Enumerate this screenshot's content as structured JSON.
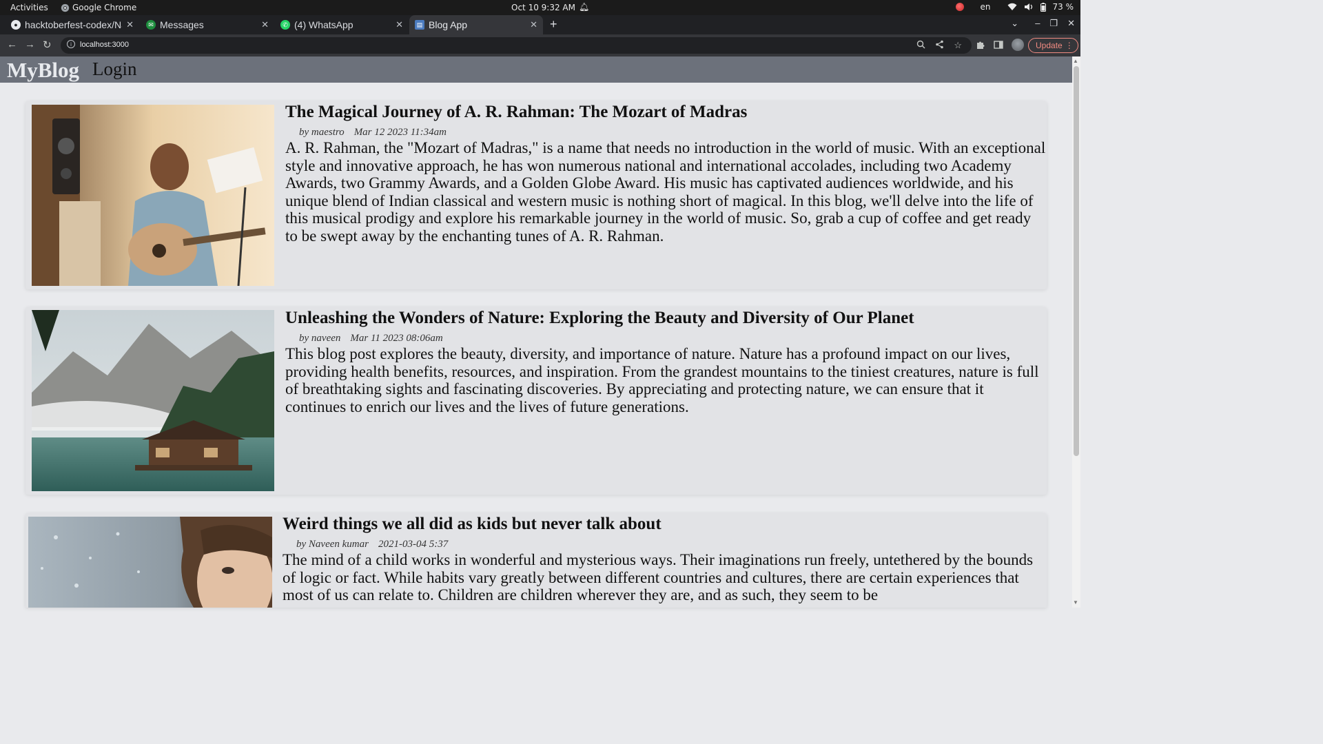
{
  "system_bar": {
    "activities": "Activities",
    "app_name": "Google Chrome",
    "clock": "Oct 10  9:32 AM",
    "language": "en",
    "battery": "73 %"
  },
  "tabs": [
    {
      "label": "hacktoberfest-codex/Na",
      "icon": "github-icon"
    },
    {
      "label": "Messages",
      "icon": "messages-icon"
    },
    {
      "label": "(4) WhatsApp",
      "icon": "whatsapp-icon"
    },
    {
      "label": "Blog App",
      "icon": "blog-icon",
      "active": true
    }
  ],
  "toolbar": {
    "url": "localhost:3000",
    "update_label": "Update"
  },
  "app": {
    "brand": "MyBlog",
    "login": "Login"
  },
  "posts": [
    {
      "title": "The Magical Journey of A. R. Rahman: The Mozart of Madras",
      "author": "by maestro",
      "date": "Mar 12 2023 11:34am",
      "body": "A. R. Rahman, the \"Mozart of Madras,\" is a name that needs no introduction in the world of music. With an exceptional style and innovative approach, he has won numerous national and international accolades, including two Academy Awards, two Grammy Awards, and a Golden Globe Award. His music has captivated audiences worldwide, and his unique blend of Indian classical and western music is nothing short of magical. In this blog, we'll delve into the life of this musical prodigy and explore his remarkable journey in the world of music. So, grab a cup of coffee and get ready to be swept away by the enchanting tunes of A. R. Rahman.",
      "image": "musician-with-guitar-photo"
    },
    {
      "title": "Unleashing the Wonders of Nature: Exploring the Beauty and Diversity of Our Planet",
      "author": "by naveen",
      "date": "Mar 11 2023 08:06am",
      "body": "This blog post explores the beauty, diversity, and importance of nature. Nature has a profound impact on our lives, providing health benefits, resources, and inspiration. From the grandest mountains to the tiniest creatures, nature is full of breathtaking sights and fascinating discoveries. By appreciating and protecting nature, we can ensure that it continues to enrich our lives and the lives of future generations.",
      "image": "mountain-lake-cabin-photo"
    },
    {
      "title": "Weird things we all did as kids but never talk about",
      "author": "by Naveen kumar",
      "date": "2021-03-04 5:37",
      "body": "The mind of a child works in wonderful and mysterious ways. Their imaginations run freely, untethered by the bounds of logic or fact. While habits vary greatly between different countries and cultures, there are certain experiences that most of us can relate to. Children are children wherever they are, and as such, they seem to be",
      "image": "child-at-rainy-window-photo"
    }
  ]
}
